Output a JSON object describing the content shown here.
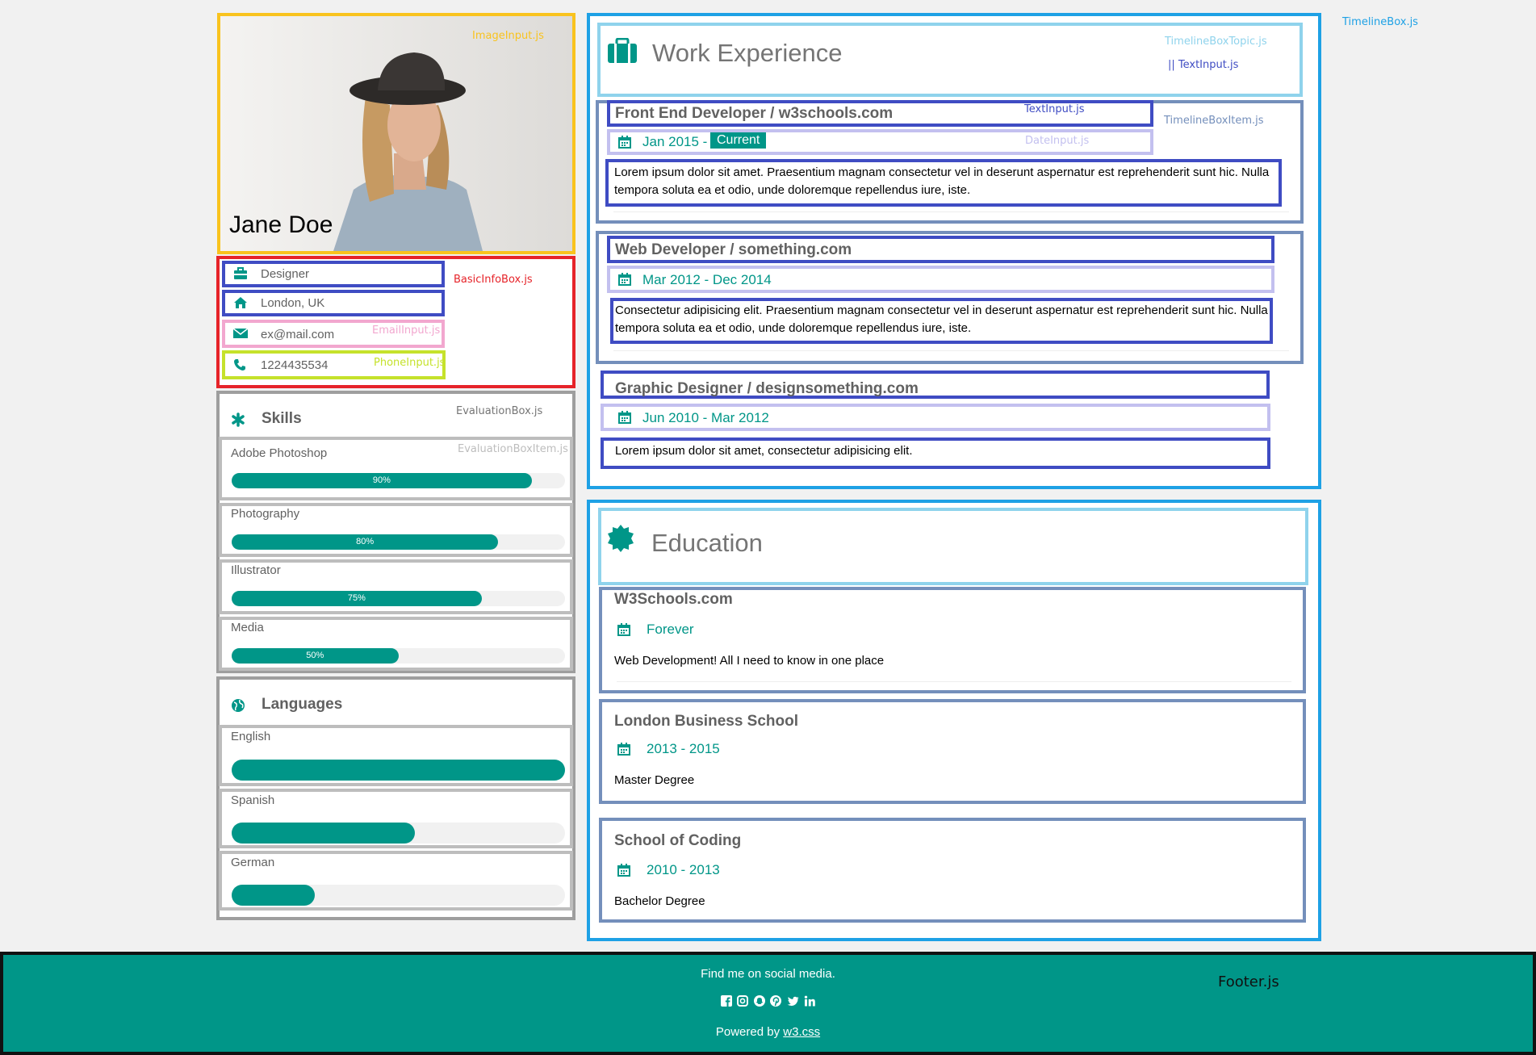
{
  "colors": {
    "accent": "#009688",
    "footer_bg": "#009688",
    "page_bg": "#f1f1f1"
  },
  "annotations": {
    "image_input": "ImageInput.js",
    "basic_info_box": "BasicInfoBox.js",
    "email_input": "EmailInput.js",
    "phone_input": "PhoneInput.js",
    "evaluation_box": "EvaluationBox.js",
    "evaluation_box_item": "EvaluationBoxItem.js",
    "timeline_box": "TimelineBox.js",
    "timeline_box_topic": "TimelineBoxTopic.js",
    "text_input_topic": "|| TextInput.js",
    "text_input": "TextInput.js",
    "timeline_box_item": "TimelineBoxItem.js",
    "date_input": "DateInput.js",
    "footer": "Footer.js"
  },
  "profile": {
    "name": "Jane Doe"
  },
  "basic_info": {
    "job": "Designer",
    "location": "London, UK",
    "email": "ex@mail.com",
    "phone": "1224435534"
  },
  "skills": {
    "title": "Skills",
    "items": [
      {
        "label": "Adobe Photoshop",
        "percent": 90,
        "text": "90%"
      },
      {
        "label": "Photography",
        "percent": 80,
        "text": "80%"
      },
      {
        "label": "Illustrator",
        "percent": 75,
        "text": "75%"
      },
      {
        "label": "Media",
        "percent": 50,
        "text": "50%"
      }
    ]
  },
  "languages": {
    "title": "Languages",
    "items": [
      {
        "label": "English",
        "percent": 100
      },
      {
        "label": "Spanish",
        "percent": 55
      },
      {
        "label": "German",
        "percent": 25
      }
    ]
  },
  "work": {
    "title": "Work Experience",
    "items": [
      {
        "title": "Front End Developer / w3schools.com",
        "date": "Jan 2015 - ",
        "badge": "Current",
        "text": "Lorem ipsum dolor sit amet. Praesentium magnam consectetur vel in deserunt aspernatur est reprehenderit sunt hic. Nulla tempora soluta ea et odio, unde doloremque repellendus iure, iste."
      },
      {
        "title": "Web Developer / something.com",
        "date": "Mar 2012 - Dec 2014",
        "text": "Consectetur adipisicing elit. Praesentium magnam consectetur vel in deserunt aspernatur est reprehenderit sunt hic. Nulla tempora soluta ea et odio, unde doloremque repellendus iure, iste."
      },
      {
        "title": "Graphic Designer / designsomething.com",
        "date": "Jun 2010 - Mar 2012",
        "text": "Lorem ipsum dolor sit amet, consectetur adipisicing elit."
      }
    ]
  },
  "education": {
    "title": "Education",
    "items": [
      {
        "title": "W3Schools.com",
        "date": "Forever",
        "text": "Web Development! All I need to know in one place"
      },
      {
        "title": "London Business School",
        "date": "2013 - 2015",
        "text": "Master Degree"
      },
      {
        "title": "School of Coding",
        "date": "2010 - 2013",
        "text": "Bachelor Degree"
      }
    ]
  },
  "footer": {
    "text": "Find me on social media.",
    "powered": "Powered by ",
    "link": "w3.css",
    "social_icons": [
      "facebook-icon",
      "instagram-icon",
      "snapchat-icon",
      "pinterest-icon",
      "twitter-icon",
      "linkedin-icon"
    ]
  }
}
